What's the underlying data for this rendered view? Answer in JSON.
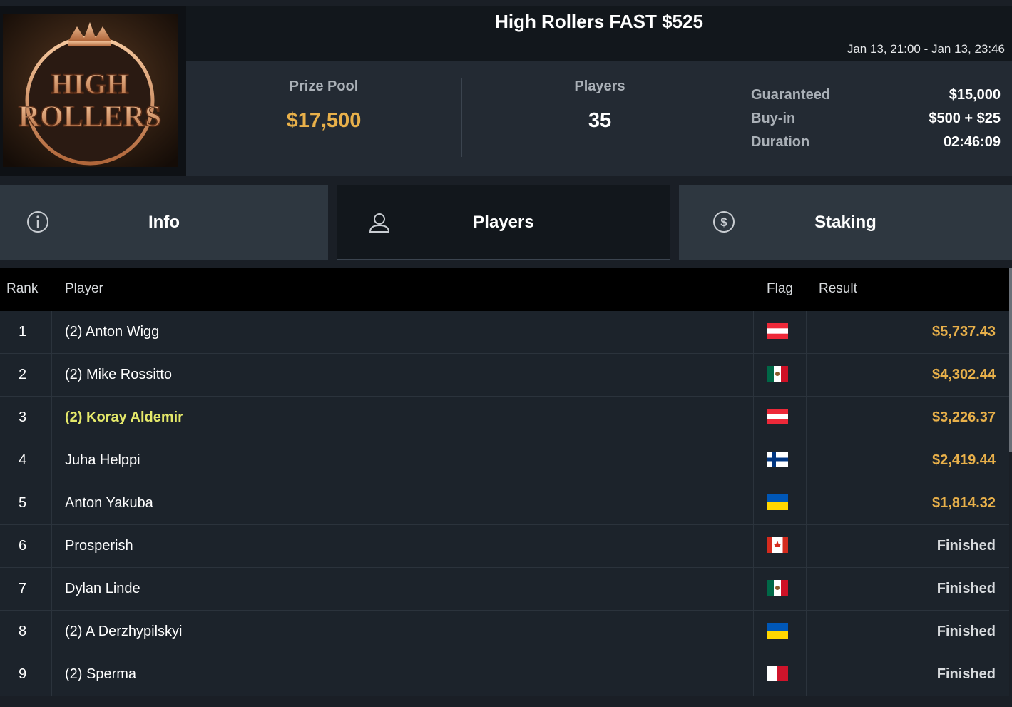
{
  "tournament": {
    "title": "High Rollers FAST $525",
    "dates": "Jan 13, 21:00 - Jan 13, 23:46",
    "logo_text": "HIGH ROLLERS"
  },
  "stats": {
    "prize_pool_label": "Prize Pool",
    "prize_pool_value": "$17,500",
    "players_label": "Players",
    "players_value": "35",
    "details": [
      {
        "key": "Guaranteed",
        "value": "$15,000"
      },
      {
        "key": "Buy-in",
        "value": "$500 + $25"
      },
      {
        "key": "Duration",
        "value": "02:46:09"
      }
    ]
  },
  "tabs": [
    {
      "label": "Info",
      "icon": "info-icon"
    },
    {
      "label": "Players",
      "icon": "user-icon",
      "active": true
    },
    {
      "label": "Staking",
      "icon": "dollar-icon"
    }
  ],
  "table": {
    "headers": {
      "rank": "Rank",
      "player": "Player",
      "flag": "Flag",
      "result": "Result"
    },
    "rows": [
      {
        "rank": "1",
        "player": "(2) Anton Wigg",
        "flag": "austria",
        "result": "$5,737.43"
      },
      {
        "rank": "2",
        "player": "(2) Mike Rossitto",
        "flag": "mexico",
        "result": "$4,302.44"
      },
      {
        "rank": "3",
        "player": "(2) Koray Aldemir",
        "flag": "austria",
        "result": "$3,226.37",
        "highlight": true
      },
      {
        "rank": "4",
        "player": "Juha Helppi",
        "flag": "finland",
        "result": "$2,419.44"
      },
      {
        "rank": "5",
        "player": "Anton Yakuba",
        "flag": "ukraine",
        "result": "$1,814.32"
      },
      {
        "rank": "6",
        "player": "Prosperish",
        "flag": "canada",
        "result": "Finished"
      },
      {
        "rank": "7",
        "player": "Dylan Linde",
        "flag": "mexico",
        "result": "Finished"
      },
      {
        "rank": "8",
        "player": "(2) A Derzhypilskyi",
        "flag": "ukraine",
        "result": "Finished"
      },
      {
        "rank": "9",
        "player": "(2) Sperma",
        "flag": "malta",
        "result": "Finished"
      }
    ]
  },
  "colors": {
    "gold": "#e8b04a",
    "highlight_player": "#e4e86a",
    "finished": "#d8dbde"
  }
}
